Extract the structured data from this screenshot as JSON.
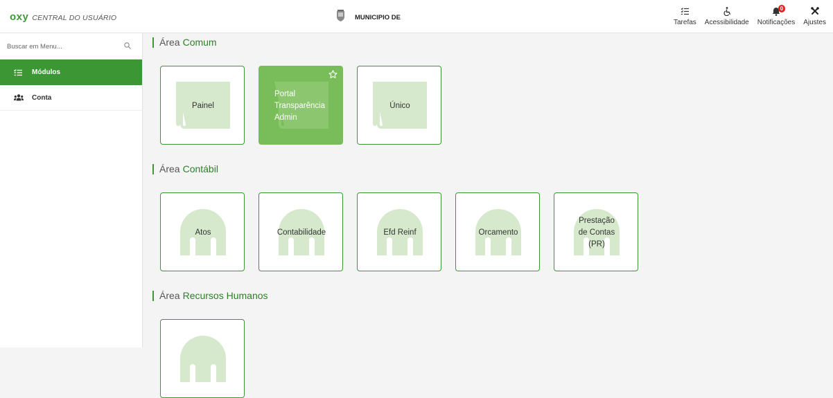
{
  "header": {
    "logo_mark": "oxy",
    "logo_text": "CENTRAL DO USUÁRIO",
    "municipio": "MUNICIPIO DE",
    "actions": [
      {
        "label": "Tarefas",
        "icon": "tasks-icon"
      },
      {
        "label": "Acessibilidade",
        "icon": "accessibility-icon"
      },
      {
        "label": "Notificações",
        "icon": "bell-icon",
        "badge": "0"
      },
      {
        "label": "Ajustes",
        "icon": "tools-icon"
      }
    ]
  },
  "sidebar": {
    "search_placeholder": "Buscar em Menu...",
    "items": [
      {
        "label": "Módulos",
        "icon": "list-icon",
        "active": true
      },
      {
        "label": "Conta",
        "icon": "users-icon",
        "active": false
      }
    ]
  },
  "sections": [
    {
      "prefix": "Área",
      "name": "Comum",
      "cards": [
        "Painel",
        "Portal Transparência Admin",
        "Único"
      ]
    },
    {
      "prefix": "Área",
      "name": "Contábil",
      "cards": [
        "Atos",
        "Contabilidade",
        "Efd Reinf",
        "Orcamento",
        "Prestação de Contas (PR)"
      ]
    },
    {
      "prefix": "Área",
      "name": "Recursos Humanos",
      "cards": [
        ""
      ]
    }
  ],
  "colors": {
    "accent": "#3c9634",
    "favorite_card": "#79bd5b",
    "art": "#d6e9cc",
    "badge": "#e02424"
  }
}
